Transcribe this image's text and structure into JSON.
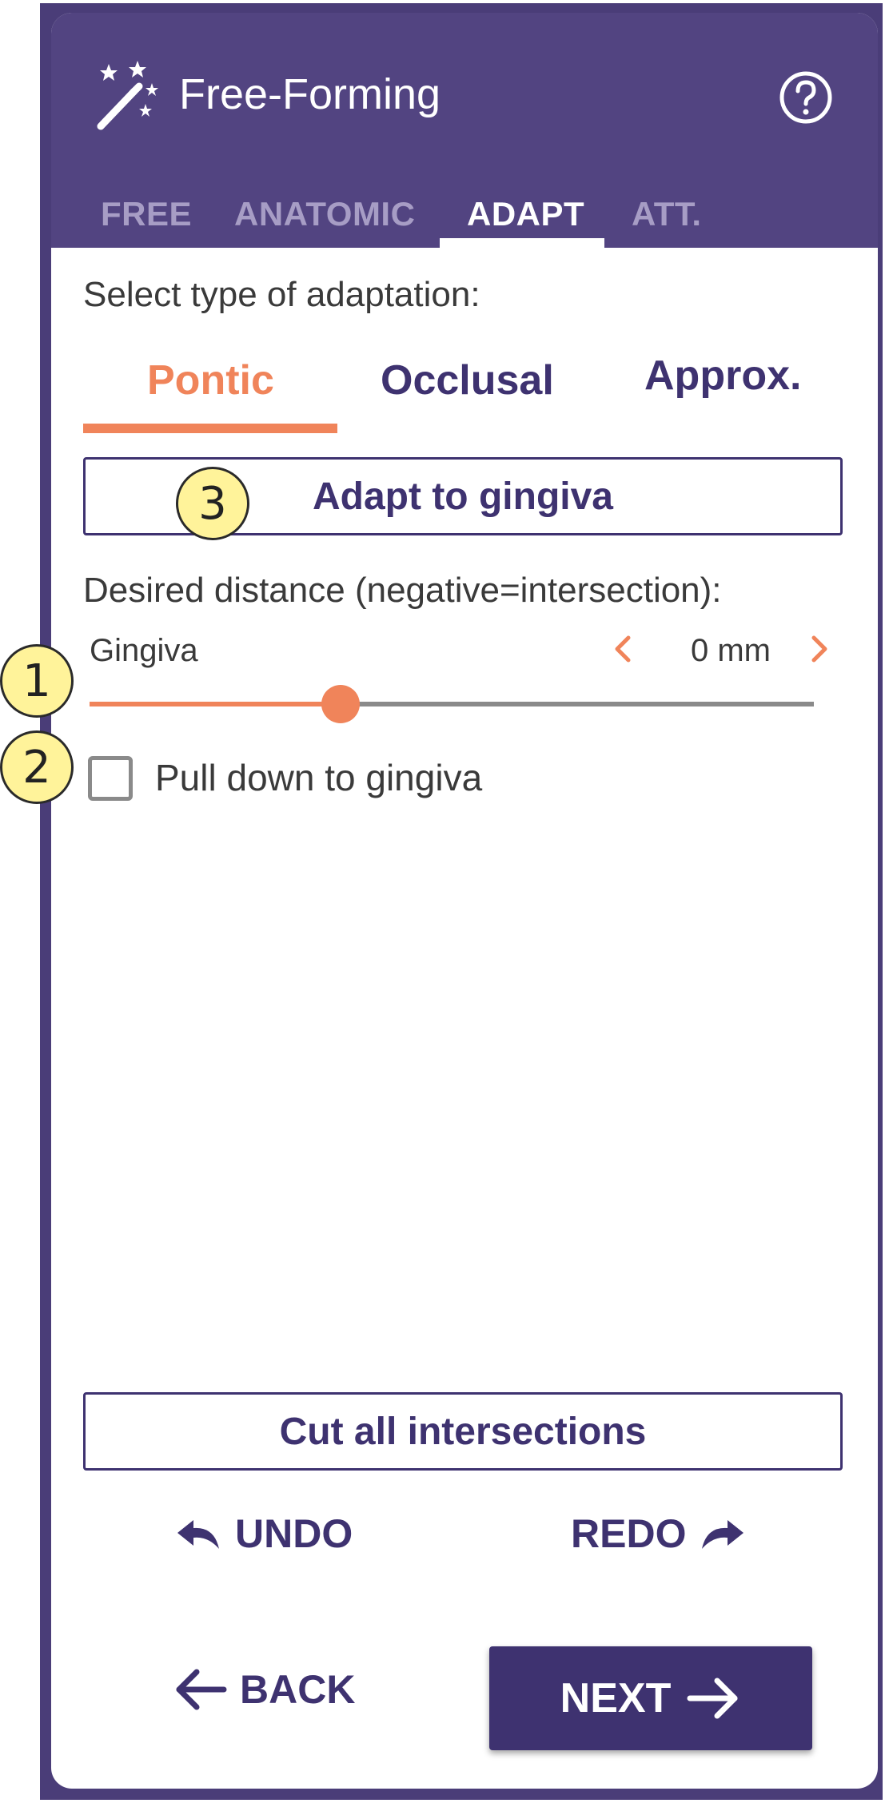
{
  "header": {
    "title": "Free-Forming",
    "icon": "magic-wand-icon",
    "help_icon": "help-circle-icon"
  },
  "tabs": [
    "FREE",
    "ANATOMIC",
    "ADAPT",
    "ATT."
  ],
  "active_tab": "ADAPT",
  "adaptation": {
    "label": "Select type of adaptation:",
    "subtabs": [
      "Pontic",
      "Occlusal",
      "Approx."
    ],
    "active_subtab": "Pontic"
  },
  "adapt_button": "Adapt to gingiva",
  "distance": {
    "label": "Desired distance (negative=intersection):",
    "slider_label": "Gingiva",
    "value": "0 mm",
    "slider_level_percent": 34.7
  },
  "checkbox": {
    "label": "Pull down to gingiva",
    "checked": false
  },
  "cut_button": "Cut all intersections",
  "undo_label": "UNDO",
  "redo_label": "REDO",
  "back_label": "BACK",
  "next_label": "NEXT",
  "annotations": [
    "1",
    "2",
    "3"
  ],
  "colors": {
    "header": "#524481",
    "accent": "#f0845a",
    "primary": "#3e3270",
    "badge": "#fff39a"
  }
}
